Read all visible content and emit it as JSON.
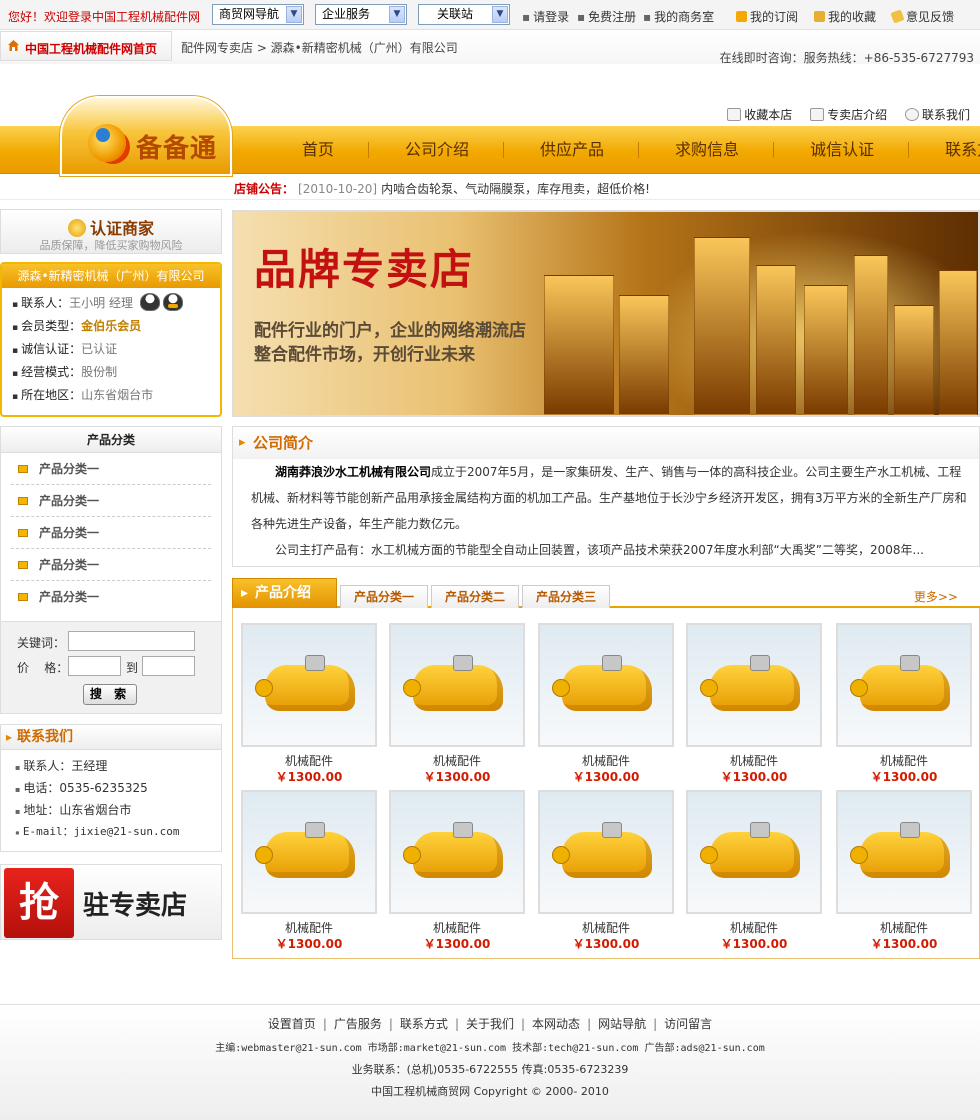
{
  "topbar": {
    "welcome_prefix": "您好！",
    "welcome_text": "欢迎登录中国工程机械配件网",
    "selects": [
      "商贸网导航",
      "企业服务",
      "关联站"
    ],
    "login": "请登录",
    "register": "免费注册",
    "my_office": "我的商务室",
    "subscribe": "我的订阅",
    "favorites": "我的收藏",
    "feedback": "意见反馈"
  },
  "bar2": {
    "home": "中国工程机械配件网首页",
    "breadcrumb": "配件网专卖店 > 源森•新精密机械（广州）有限公司",
    "hotline": "在线即时咨询：服务热线：+86-535-6727793"
  },
  "header": {
    "logo_text": "备备通",
    "shop_links": [
      "收藏本店",
      "专卖店介绍",
      "联系我们"
    ],
    "nav": [
      "首页",
      "公司介绍",
      "供应产品",
      "求购信息",
      "诚信认证",
      "联系方式"
    ],
    "notice_label": "店铺公告：",
    "notice_date": "[2010-10-20]",
    "notice_text": "内啮合齿轮泵、气动隔膜泵，库存甩卖，超低价格!"
  },
  "sidebar": {
    "cert_title": "认证商家",
    "cert_sub": "品质保障，降低买家购物风险",
    "company_name": "源森•新精密机械（广州）有限公司",
    "info": [
      {
        "k": "联系人：",
        "v": "王小明  经理"
      },
      {
        "k": "会员类型：",
        "v": "金伯乐会员"
      },
      {
        "k": "诚信认证：",
        "v": "已认证"
      },
      {
        "k": "经营模式：",
        "v": "股份制"
      },
      {
        "k": "所在地区：",
        "v": "山东省烟台市"
      }
    ],
    "category_title": "产品分类",
    "categories": [
      "产品分类一",
      "产品分类一",
      "产品分类一",
      "产品分类一",
      "产品分类一"
    ],
    "search": {
      "keyword_label": "关键词：",
      "price_label": "价    格：",
      "to_label": "到",
      "button": "搜 索"
    },
    "contact_title": "联系我们",
    "contact": [
      "联系人：王经理",
      "电话：0535-6235325",
      "地址：山东省烟台市",
      "E-mail：jixie@21-sun.com"
    ],
    "ad_char": "抢",
    "ad_text": "驻专卖店"
  },
  "banner": {
    "title": "品牌专卖店",
    "line1": "配件行业的门户，企业的网络潮流店",
    "line2": "整合配件市场，开创行业未来"
  },
  "intro": {
    "title": "公司简介",
    "company": "湖南莽浪沙水工机械有限公司",
    "p1": "成立于2007年5月，是一家集研发、生产、销售与一体的高科技企业。公司主要生产水工机械、工程机械、新材料等节能创新产品用承接金属结构方面的机加工产品。生产基地位于长沙宁乡经济开发区，拥有3万平方米的全新生产厂房和各种先进生产设备，年生产能力数亿元。",
    "p2": "公司主打产品有：水工机械方面的节能型全自动止回装置，该项产品技术荣获2007年度水利部“大禹奖”二等奖，2008年..."
  },
  "products": {
    "title": "产品介绍",
    "tabs": [
      "产品分类一",
      "产品分类二",
      "产品分类三"
    ],
    "more": "更多>>",
    "items": [
      {
        "name": "机械配件",
        "price": "￥1300.00"
      },
      {
        "name": "机械配件",
        "price": "￥1300.00"
      },
      {
        "name": "机械配件",
        "price": "￥1300.00"
      },
      {
        "name": "机械配件",
        "price": "￥1300.00"
      },
      {
        "name": "机械配件",
        "price": "￥1300.00"
      },
      {
        "name": "机械配件",
        "price": "￥1300.00"
      },
      {
        "name": "机械配件",
        "price": "￥1300.00"
      },
      {
        "name": "机械配件",
        "price": "￥1300.00"
      },
      {
        "name": "机械配件",
        "price": "￥1300.00"
      },
      {
        "name": "机械配件",
        "price": "￥1300.00"
      }
    ]
  },
  "footer": {
    "links": [
      "设置首页",
      "广告服务",
      "联系方式",
      "关于我们",
      "本网动态",
      "网站导航",
      "访问留言"
    ],
    "line1": "主编:webmaster@21-sun.com 市场部:market@21-sun.com 技术部:tech@21-sun.com 广告部:ads@21-sun.com",
    "line2": "业务联系：(总机)0535-6722555  传真:0535-6723239",
    "line3": "中国工程机械商贸网 Copyright © 2000- 2010"
  },
  "colors": {
    "accent": "#f2a900",
    "price": "#d21b00",
    "brand_red": "#c00000"
  }
}
